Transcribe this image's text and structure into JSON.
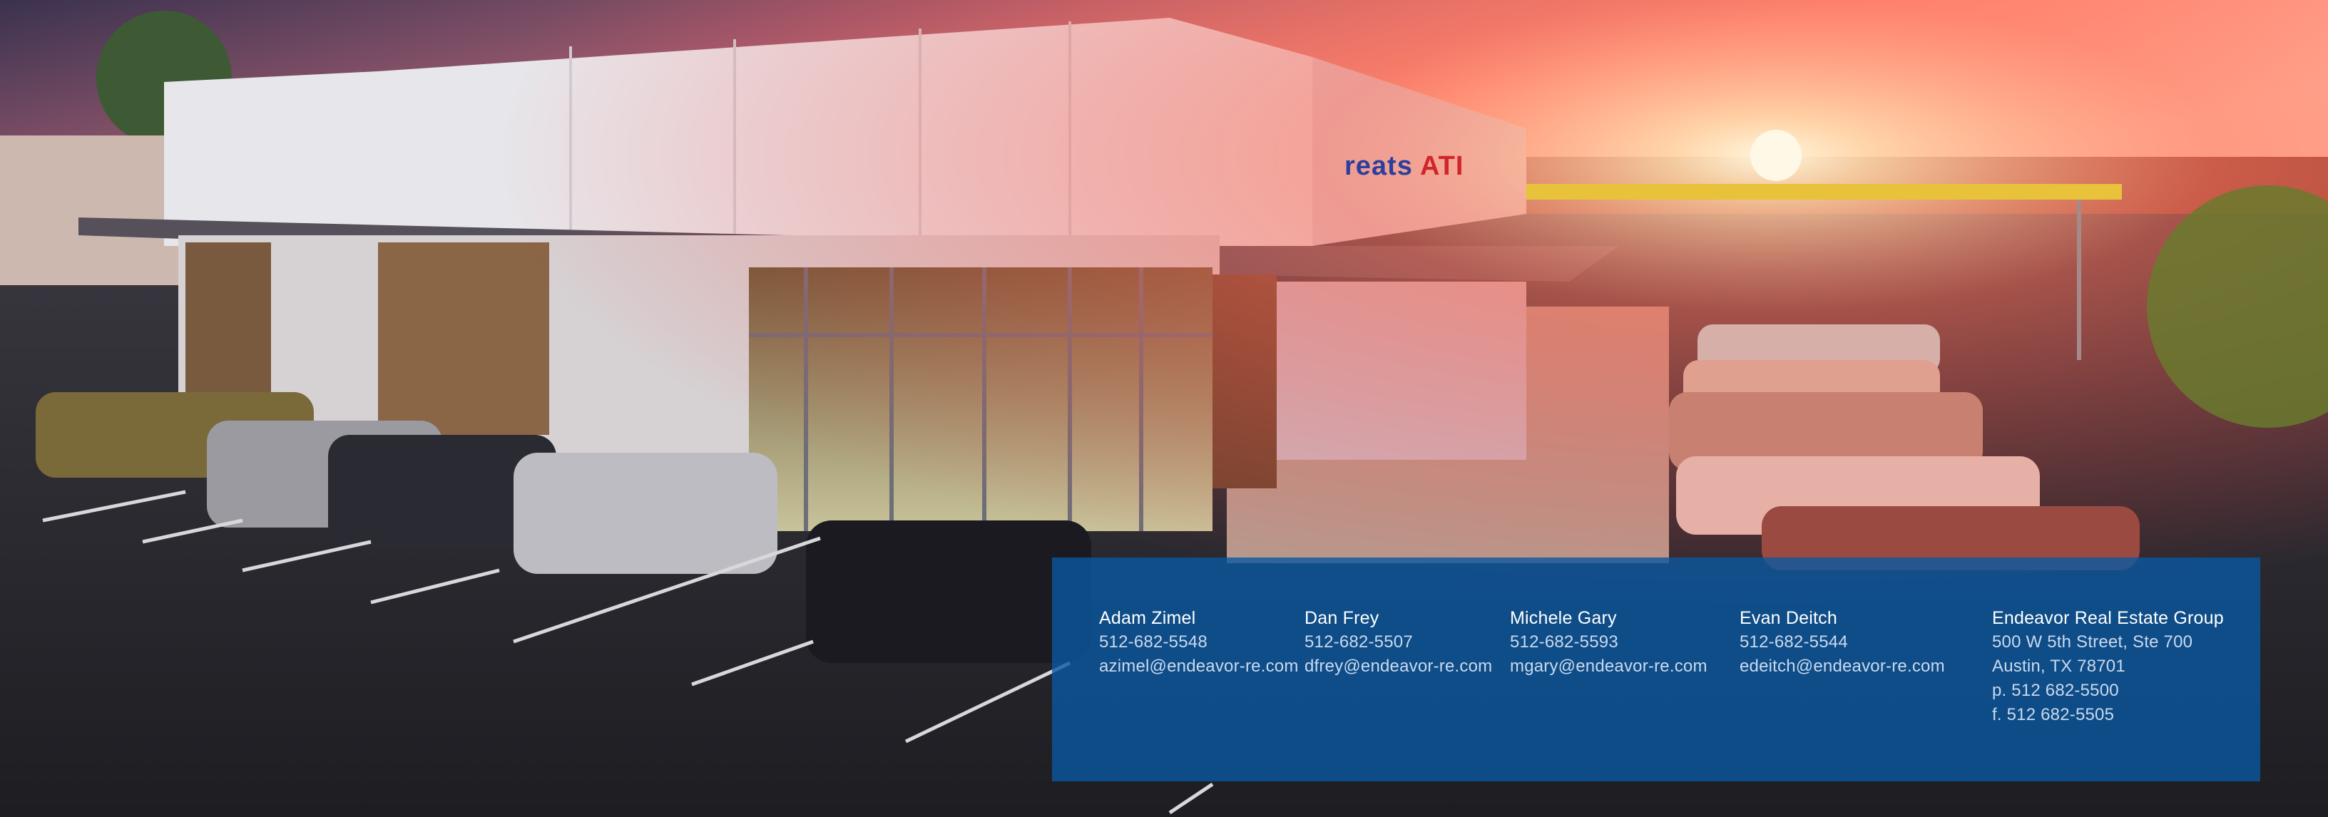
{
  "scene": {
    "sign_text_left": "reats",
    "sign_text_brand": "ATI"
  },
  "colors": {
    "panel": "#0a58a0",
    "sky_top": "#3b3350",
    "sunset": "#ff7a5c",
    "asphalt": "#26262c",
    "building": "#e9e9ed"
  },
  "contacts": [
    {
      "name": "Adam Zimel",
      "phone": "512-682-5548",
      "email": "azimel@endeavor-re.com"
    },
    {
      "name": "Dan Frey",
      "phone": "512-682-5507",
      "email": "dfrey@endeavor-re.com"
    },
    {
      "name": "Michele Gary",
      "phone": "512-682-5593",
      "email": "mgary@endeavor-re.com"
    },
    {
      "name": "Evan Deitch",
      "phone": "512-682-5544",
      "email": "edeitch@endeavor-re.com"
    }
  ],
  "company": {
    "name": "Endeavor Real Estate Group",
    "street": "500 W 5th Street, Ste 700",
    "city": "Austin, TX 78701",
    "phone": "p. 512 682-5500",
    "fax": "f.  512 682-5505"
  }
}
